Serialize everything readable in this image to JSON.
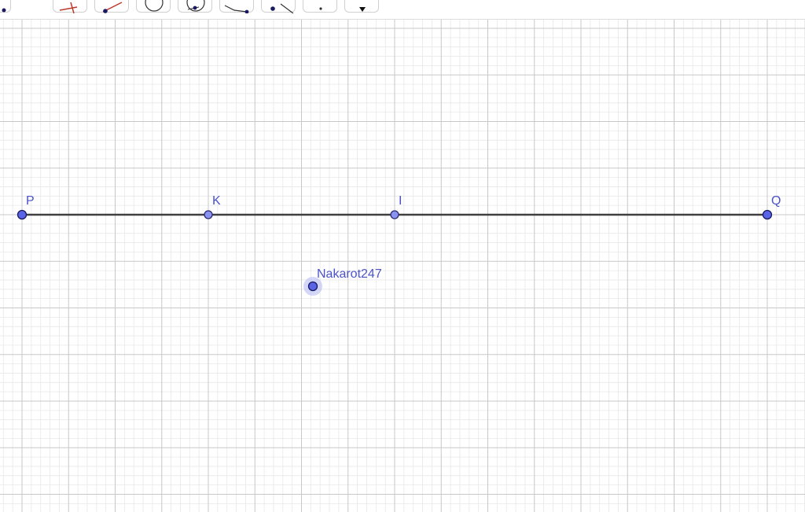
{
  "toolbar": {
    "tools": [
      {
        "name": "move-tool",
        "icon": "arrow-icon"
      },
      {
        "name": "point-tool",
        "icon": "perpendicular-line-icon"
      },
      {
        "name": "line-tool",
        "icon": "line-through-points-icon"
      },
      {
        "name": "perpendicular-tool",
        "icon": "circle-icon"
      },
      {
        "name": "polygon-tool",
        "icon": "circle-through-point-icon"
      },
      {
        "name": "circle-tool",
        "icon": "polygon-icon"
      },
      {
        "name": "angle-tool",
        "icon": "angle-icon"
      },
      {
        "name": "reflect-tool",
        "icon": "point-icon"
      },
      {
        "name": "text-tool",
        "icon": "pen-icon"
      }
    ]
  },
  "graphics": {
    "grid": true,
    "segment": {
      "label_start": "P",
      "label_end": "Q"
    },
    "points": [
      {
        "label": "P"
      },
      {
        "label": "K"
      },
      {
        "label": "I"
      },
      {
        "label": "Q"
      }
    ],
    "free_point": {
      "label": "Nakarot247",
      "selected": true
    },
    "colors": {
      "point_fill": "#5a64e6",
      "point_stroke": "#1a1a60",
      "label": "#4a52c8",
      "segment": "#404040",
      "grid_major": "#c8c8c8",
      "grid_minor": "#e8e8e8"
    }
  }
}
